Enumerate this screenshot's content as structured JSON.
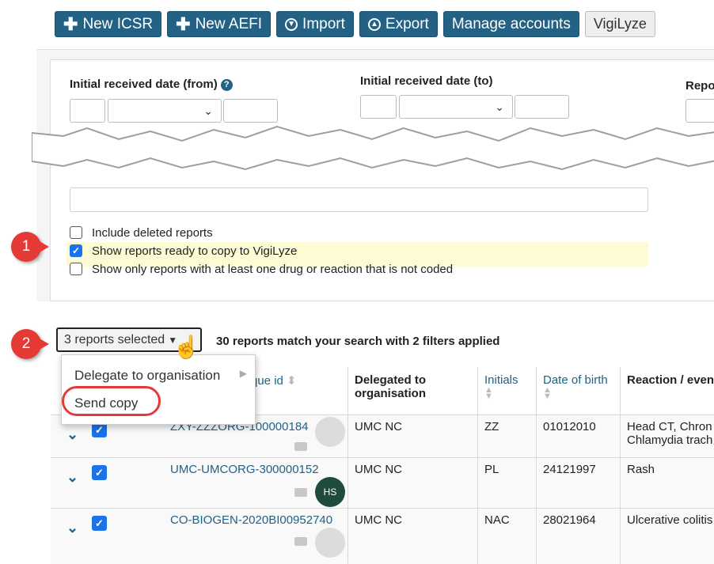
{
  "toolbar": {
    "new_icsr": "New ICSR",
    "new_aefi": "New AEFI",
    "import": "Import",
    "export": "Export",
    "manage_accounts": "Manage accounts",
    "vigilyze": "VigiLyze"
  },
  "filters": {
    "date_from_label": "Initial received date (from)",
    "date_to_label": "Initial received date (to)",
    "third_label": "Repo",
    "checkboxes": [
      {
        "label": "Include deleted reports",
        "checked": false
      },
      {
        "label": "Show reports ready to copy to VigiLyze",
        "checked": true
      },
      {
        "label": "Show only reports with at least one drug or reaction that is not coded",
        "checked": false
      }
    ]
  },
  "markers": {
    "one": "1",
    "two": "2"
  },
  "results": {
    "selected_label": "3 reports selected",
    "match_text": "30 reports match your search with 2 filters applied"
  },
  "dropdown": {
    "items": [
      "Delegate to organisation",
      "Send copy"
    ]
  },
  "table": {
    "headers": {
      "unique_id": "que id",
      "delegated": "Delegated to organisation",
      "initials": "Initials",
      "dob": "Date of birth",
      "reaction": "Reaction / even"
    },
    "rows": [
      {
        "id": "ZXY-ZZZORG-100000184",
        "delegated": "UMC NC",
        "initials": "ZZ",
        "dob": "01012010",
        "reaction": "Head CT, Chron",
        "reaction2": "Chlamydia trach",
        "avatar": ""
      },
      {
        "id": "UMC-UMCORG-300000152",
        "delegated": "UMC NC",
        "initials": "PL",
        "dob": "24121997",
        "reaction": "Rash",
        "reaction2": "",
        "avatar": "HS"
      },
      {
        "id": "CO-BIOGEN-2020BI00952740",
        "delegated": "UMC NC",
        "initials": "NAC",
        "dob": "28021964",
        "reaction": "Ulcerative colitis",
        "reaction2": "",
        "avatar": ""
      }
    ]
  },
  "colors": {
    "primary": "#236185",
    "checkbox": "#1a73e8",
    "marker": "#e53935",
    "highlight": "#fdfbd3"
  }
}
